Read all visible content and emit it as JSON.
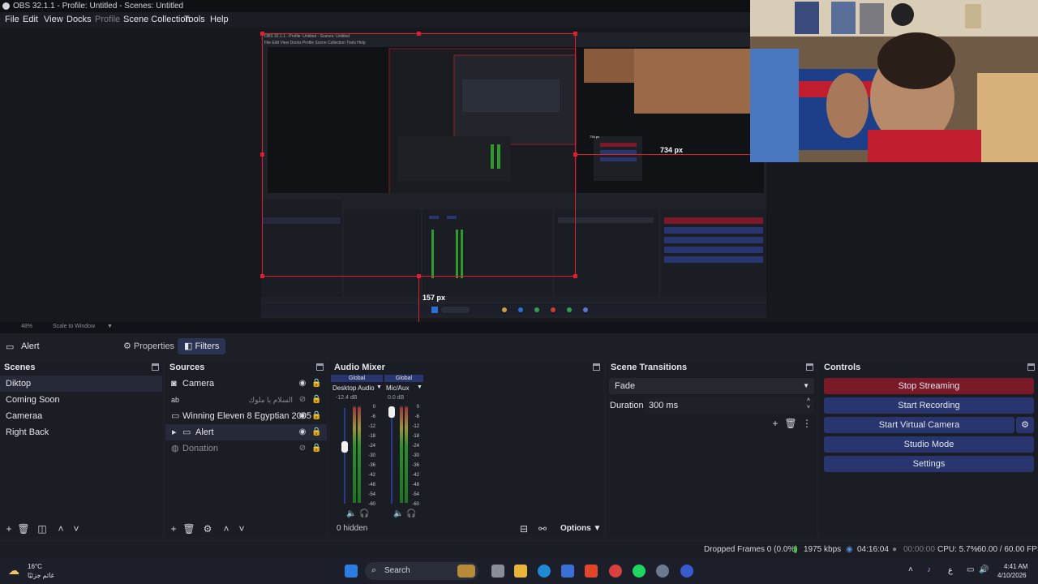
{
  "window": {
    "title": "OBS 32.1.1 - Profile: Untitled - Scenes: Untitled"
  },
  "menu": [
    "File",
    "Edit",
    "View",
    "Docks",
    "Profile",
    "Scene Collection",
    "Tools",
    "Help"
  ],
  "preview": {
    "nested_title": "OBS 32.1.1 - Profile: Untitled - Scenes: Untitled",
    "nested_menu": "File  Edit  View  Docks  Profile  Scene Collection  Tools  Help",
    "guide_right_label": "734 px",
    "guide_bottom_label": "157 px"
  },
  "zoombar": {
    "zoom": "48%",
    "scale_mode": "Scale to Window"
  },
  "context": {
    "source_name": "Alert",
    "properties_label": "Properties",
    "filters_label": "Filters"
  },
  "scenes": {
    "title": "Scenes",
    "items": [
      "Diktop",
      "Coming Soon",
      "Cameraa",
      "Right Back"
    ]
  },
  "sources": {
    "title": "Sources",
    "items": [
      {
        "name": "Camera",
        "icon": "camera-icon"
      },
      {
        "name": "السلام يا ملوك",
        "icon": "text-icon"
      },
      {
        "name": "Winning Eleven 8 Egyptian 2005",
        "icon": "monitor-icon"
      },
      {
        "name": "Alert",
        "icon": "folder-icon"
      },
      {
        "name": "Donation",
        "icon": "globe-icon"
      }
    ]
  },
  "mixer": {
    "title": "Audio Mixer",
    "channels": [
      {
        "badge": "Global",
        "name": "Desktop Audio",
        "db": "-12.4 dB"
      },
      {
        "badge": "Global",
        "name": "Mic/Aux",
        "db": "0.0 dB"
      }
    ],
    "scale": [
      "0",
      "-6",
      "-12",
      "-18",
      "-24",
      "-30",
      "-36",
      "-42",
      "-48",
      "-54",
      "-60"
    ],
    "hidden_label": "0 hidden",
    "options_label": "Options"
  },
  "transitions": {
    "title": "Scene Transitions",
    "selected": "Fade",
    "duration_label": "Duration",
    "duration_value": "300 ms"
  },
  "controls": {
    "title": "Controls",
    "stop_streaming": "Stop Streaming",
    "start_recording": "Start Recording",
    "start_virtual_camera": "Start Virtual Camera",
    "studio_mode": "Studio Mode",
    "settings": "Settings"
  },
  "status": {
    "dropped_frames": "Dropped Frames 0 (0.0%)",
    "bitrate": "1975 kbps",
    "stream_time": "04:16:04",
    "record_time": "00:00:00",
    "cpu": "CPU: 5.7%",
    "fps": "60.00 / 60.00 FPS"
  },
  "taskbar": {
    "weather_temp": "16°C",
    "weather_desc": "غائم جزئيًا",
    "search_label": "Search",
    "lang": "ع",
    "time": "4:41 AM",
    "date": "4/10/2026"
  },
  "colors": {
    "accent": "#28356e",
    "danger": "#7a1a29",
    "guide_red": "#e01f2e"
  }
}
